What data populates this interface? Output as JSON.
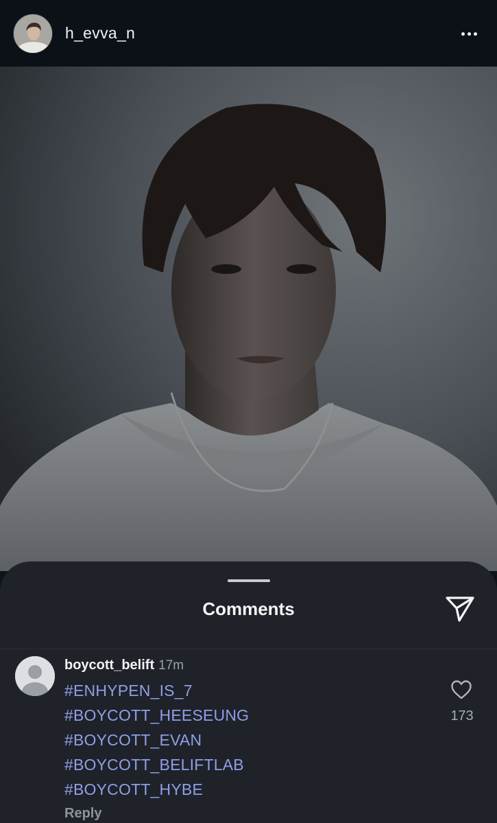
{
  "post": {
    "username": "h_evva_n",
    "icons": {
      "avatar": "profile-photo",
      "more": "three-dots-icon",
      "photo": "portrait-photo"
    }
  },
  "comments_sheet": {
    "title": "Comments",
    "icons": {
      "handle": "drag-handle",
      "share": "paper-plane-icon"
    },
    "comments": [
      {
        "username": "boycott_belift",
        "time": "17m",
        "hashtags": [
          "#ENHYPEN_IS_7",
          "#BOYCOTT_HEESEUNG",
          "#BOYCOTT_EVAN",
          "#BOYCOTT_BELIFTLAB",
          "#BOYCOTT_HYBE"
        ],
        "reply_label": "Reply",
        "likes": "173",
        "icons": {
          "avatar": "default-user-avatar",
          "like": "heart-icon"
        }
      }
    ]
  },
  "colors": {
    "background": "#0f131a",
    "sheet": "#1f2229",
    "hashtag": "#8f9fe8",
    "muted": "#9aa0a8"
  }
}
